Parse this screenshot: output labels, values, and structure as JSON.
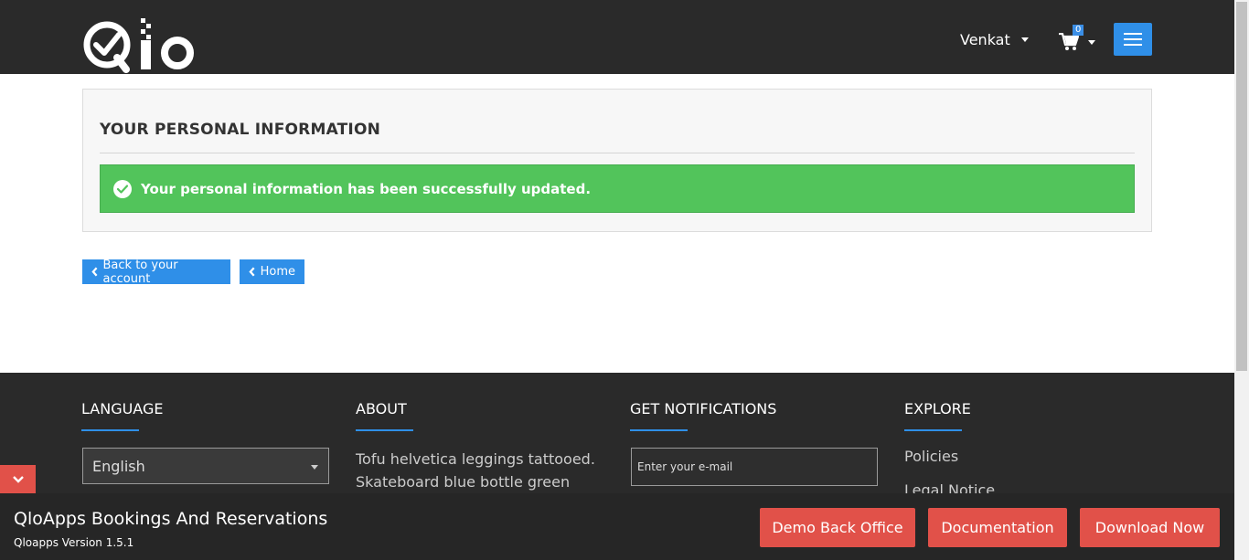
{
  "header": {
    "user_name": "Venkat",
    "cart_count": "0"
  },
  "main": {
    "title": "YOUR PERSONAL INFORMATION",
    "success_message": "Your personal information has been successfully updated.",
    "back_button": "Back to your account",
    "home_button": "Home"
  },
  "footer": {
    "language": {
      "title": "LANGUAGE",
      "selected": "English"
    },
    "about": {
      "title": "ABOUT",
      "text": "Tofu helvetica leggings tattooed. Skateboard blue bottle green juice,"
    },
    "notifications": {
      "title": "GET NOTIFICATIONS",
      "email_placeholder": "Enter your e-mail"
    },
    "explore": {
      "title": "EXPLORE",
      "links": [
        "Policies",
        "Legal Notice"
      ]
    }
  },
  "demo_bar": {
    "title": "QloApps Bookings And Reservations",
    "version": "Qloapps Version 1.5.1",
    "buttons": [
      "Demo Back Office",
      "Documentation",
      "Download Now"
    ]
  },
  "colors": {
    "header_bg": "#2a2a2a",
    "accent_blue": "#2f8fe8",
    "success_green": "#52c45b",
    "demo_red": "#e15149"
  },
  "icons": [
    "qlo-logo",
    "cart-icon",
    "hamburger-icon",
    "check-circle-icon",
    "chevron-left-icon",
    "chevron-down-icon"
  ]
}
